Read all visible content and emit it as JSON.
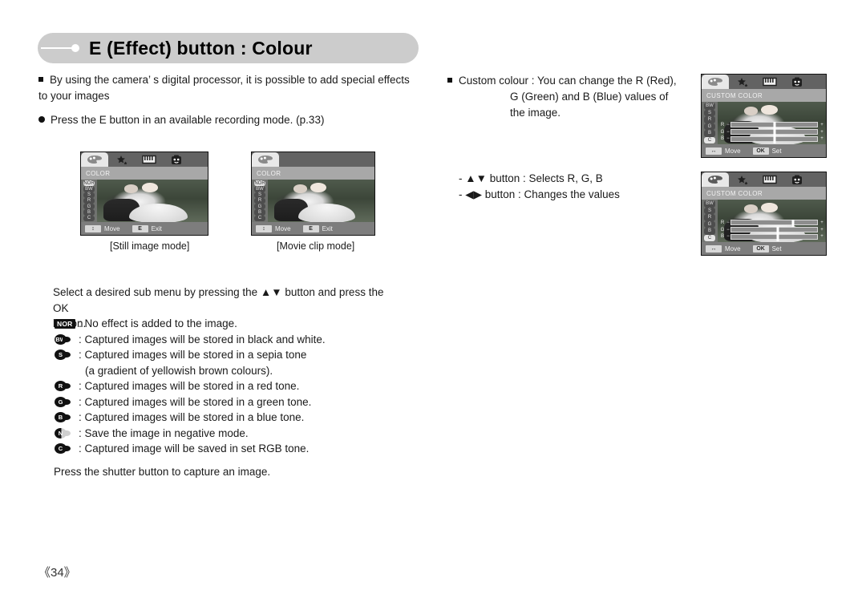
{
  "header": {
    "title": "E (Effect) button : Colour"
  },
  "left_column": {
    "bullet1": "By using the camera’ s digital processor, it is possible to add special effects to your images",
    "bullet2": "Press the E button in an available recording mode. (p.33)",
    "instruction_line1": "Select a desired sub menu by pressing the ▲▼ button and press the OK",
    "instruction_line2": "button.",
    "closing": "Press the shutter button to capture an image."
  },
  "effects": [
    {
      "icon": "NOR",
      "icon_type": "rect",
      "text": ": No effect is added to the image."
    },
    {
      "icon": "BW",
      "icon_type": "oval",
      "text": ": Captured images will be stored in black and white."
    },
    {
      "icon": "S",
      "icon_type": "oval",
      "text": ": Captured images will be stored in a sepia tone",
      "sub": "(a gradient of yellowish brown colours)."
    },
    {
      "icon": "R",
      "icon_type": "oval",
      "text": ": Captured images will be stored in a red tone."
    },
    {
      "icon": "G",
      "icon_type": "oval",
      "text": ": Captured images will be stored in a green tone."
    },
    {
      "icon": "B",
      "icon_type": "oval",
      "text": ": Captured images will be stored in a blue tone."
    },
    {
      "icon": "N",
      "icon_type": "oval-half",
      "text": ": Save the image in negative mode."
    },
    {
      "icon": "C",
      "icon_type": "oval",
      "text": ": Captured image will be saved in set RGB tone."
    }
  ],
  "right_column": {
    "bullet1_line1": "Custom colour : You can change the R (Red),",
    "bullet1_line2": "G (Green) and B (Blue) values of",
    "bullet1_line3": "the image.",
    "note1": "- ▲▼ button : Selects R, G, B",
    "note2": "- ◀▶ button : Changes the values"
  },
  "screens": {
    "still": {
      "title": "COLOR",
      "move_label": "Move",
      "exit_key": "E",
      "exit_label": "Exit",
      "move_key": "divide-arrow-icon",
      "tabs": [
        "palette-icon",
        "sparkle-icon",
        "film-icon",
        "face-icon"
      ],
      "side_items": [
        "NOR",
        "BW",
        "S",
        "R",
        "G",
        "B",
        "C"
      ],
      "selected_index": 0,
      "caption": "[Still image mode]"
    },
    "movie": {
      "title": "COLOR",
      "move_label": "Move",
      "exit_key": "E",
      "exit_label": "Exit",
      "tabs": [
        "palette-icon"
      ],
      "side_items": [
        "NOR",
        "BW",
        "S",
        "R",
        "G",
        "B",
        "C"
      ],
      "selected_index": 0,
      "caption": "[Movie clip mode]"
    },
    "custom1": {
      "title": "CUSTOM COLOR",
      "move_label": "Move",
      "set_key": "OK",
      "set_label": "Set",
      "tabs": [
        "palette-icon",
        "sparkle-icon",
        "film-icon",
        "face-icon"
      ],
      "side_items": [
        "BW",
        "S",
        "R",
        "G",
        "B",
        "C"
      ],
      "selected_index": 5,
      "sliders": [
        {
          "label": "R",
          "value": 50
        },
        {
          "label": "G",
          "value": 50
        },
        {
          "label": "B",
          "value": 50
        }
      ]
    },
    "custom2": {
      "title": "CUSTOM COLOR",
      "move_label": "Move",
      "set_key": "OK",
      "set_label": "Set",
      "tabs": [
        "palette-icon",
        "sparkle-icon",
        "film-icon",
        "face-icon"
      ],
      "side_items": [
        "BW",
        "S",
        "R",
        "G",
        "B",
        "C"
      ],
      "selected_index": 5,
      "sliders": [
        {
          "label": "R",
          "value": 72
        },
        {
          "label": "G",
          "value": 54
        },
        {
          "label": "B",
          "value": 54
        }
      ]
    }
  },
  "footer": {
    "page_number": "《34》"
  }
}
